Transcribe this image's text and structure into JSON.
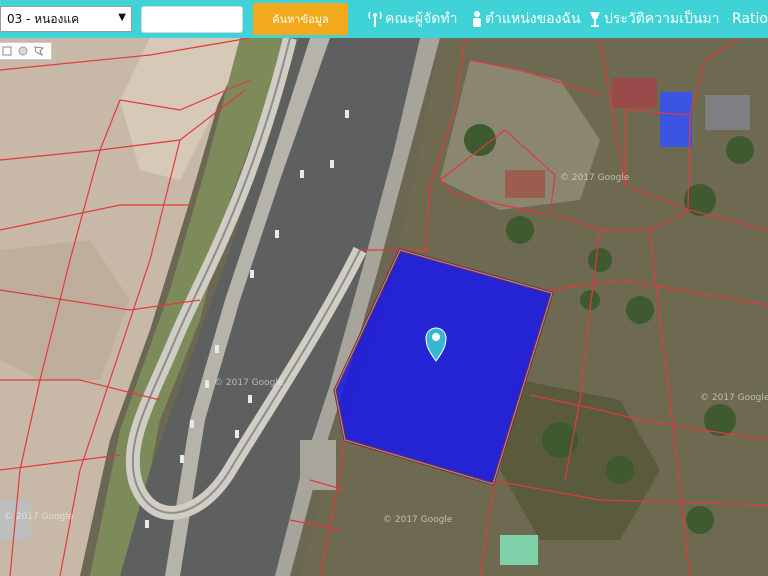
{
  "district_select": {
    "value": "03 - หนองแค"
  },
  "search": {
    "placeholder": "",
    "button_label": "ค้นหาข้อมูล"
  },
  "nav": {
    "committee": "คณะผู้จัดทำ",
    "my_location": "ตำแหน่งของฉัน",
    "history": "ประวัติความเป็นมา",
    "ratio": "Ratio"
  },
  "map": {
    "watermarks": [
      "© 2017 Google",
      "© 2017 Google",
      "© 2017 Google",
      "© 2017 Google",
      "© 2017 Google"
    ],
    "parcel_fill": "#1a1ae6",
    "parcel_border": "#b01818",
    "boundary_color": "#e23a3a",
    "marker_color": "#36b7d6"
  },
  "draw_tools": [
    "square-tool-icon",
    "circle-tool-icon",
    "polygon-tool-icon"
  ]
}
